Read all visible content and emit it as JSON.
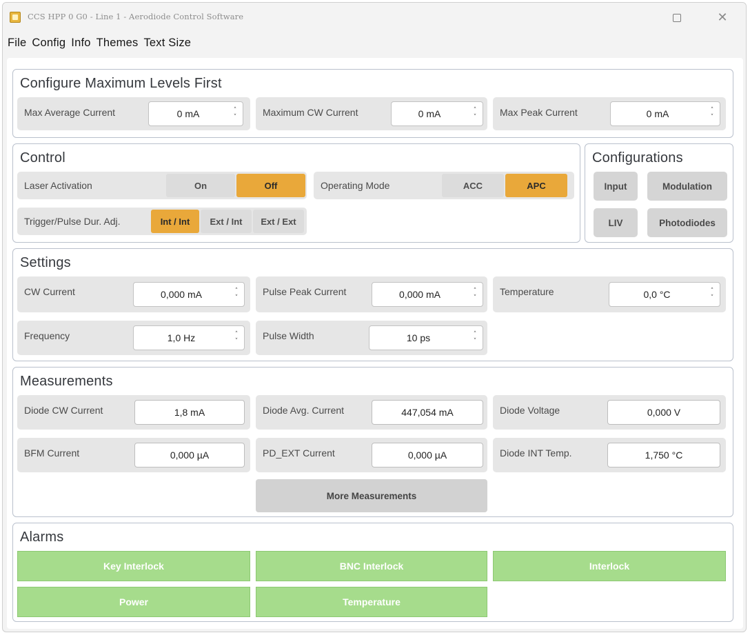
{
  "window": {
    "title": "CCS HPP 0 G0 - Line 1 - Aerodiode Control Software",
    "app_icon": "app-icon",
    "controls": {
      "maximize_icon": "maximize-icon",
      "close_icon": "close-icon",
      "close_glyph": "✕"
    }
  },
  "menu": [
    "File",
    "Config",
    "Info",
    "Themes",
    "Text Size"
  ],
  "max_levels": {
    "title": "Configure Maximum Levels First",
    "fields": [
      {
        "label": "Max Average Current",
        "value": "0 mA"
      },
      {
        "label": "Maximum CW Current",
        "value": "0 mA"
      },
      {
        "label": "Max Peak Current",
        "value": "0 mA"
      }
    ]
  },
  "control": {
    "title": "Control",
    "laser_activation": {
      "label": "Laser Activation",
      "options": [
        "On",
        "Off"
      ],
      "selected": "Off"
    },
    "operating_mode": {
      "label": "Operating Mode",
      "options": [
        "ACC",
        "APC"
      ],
      "selected": "APC"
    },
    "trigger": {
      "label": "Trigger/Pulse Dur. Adj.",
      "options": [
        "Int / Int",
        "Ext / Int",
        "Ext / Ext"
      ],
      "selected": "Int / Int"
    }
  },
  "configurations": {
    "title": "Configurations",
    "buttons": [
      "Input",
      "Modulation",
      "LIV",
      "Photodiodes"
    ]
  },
  "settings": {
    "title": "Settings",
    "fields": [
      {
        "label": "CW Current",
        "value": "0,000 mA"
      },
      {
        "label": "Pulse Peak Current",
        "value": "0,000 mA"
      },
      {
        "label": "Temperature",
        "value": "0,0 °C"
      },
      {
        "label": "Frequency",
        "value": "1,0 Hz"
      },
      {
        "label": "Pulse Width",
        "value": "10 ps"
      }
    ]
  },
  "measurements": {
    "title": "Measurements",
    "fields": [
      {
        "label": "Diode CW Current",
        "value": "1,8 mA"
      },
      {
        "label": "Diode Avg. Current",
        "value": "447,054 mA"
      },
      {
        "label": "Diode Voltage",
        "value": "0,000 V"
      },
      {
        "label": "BFM Current",
        "value": "0,000 µA"
      },
      {
        "label": "PD_EXT Current",
        "value": "0,000 µA"
      },
      {
        "label": "Diode INT Temp.",
        "value": "1,750 °C"
      }
    ],
    "more_button": "More Measurements"
  },
  "alarms": {
    "title": "Alarms",
    "items": [
      "Key Interlock",
      "BNC Interlock",
      "Interlock",
      "Power",
      "Temperature"
    ],
    "ok_color": "#a6dc8c"
  },
  "colors": {
    "accent": "#e9a83a",
    "alarm_ok": "#a6dc8c",
    "panel_border": "#b9c0cc"
  }
}
